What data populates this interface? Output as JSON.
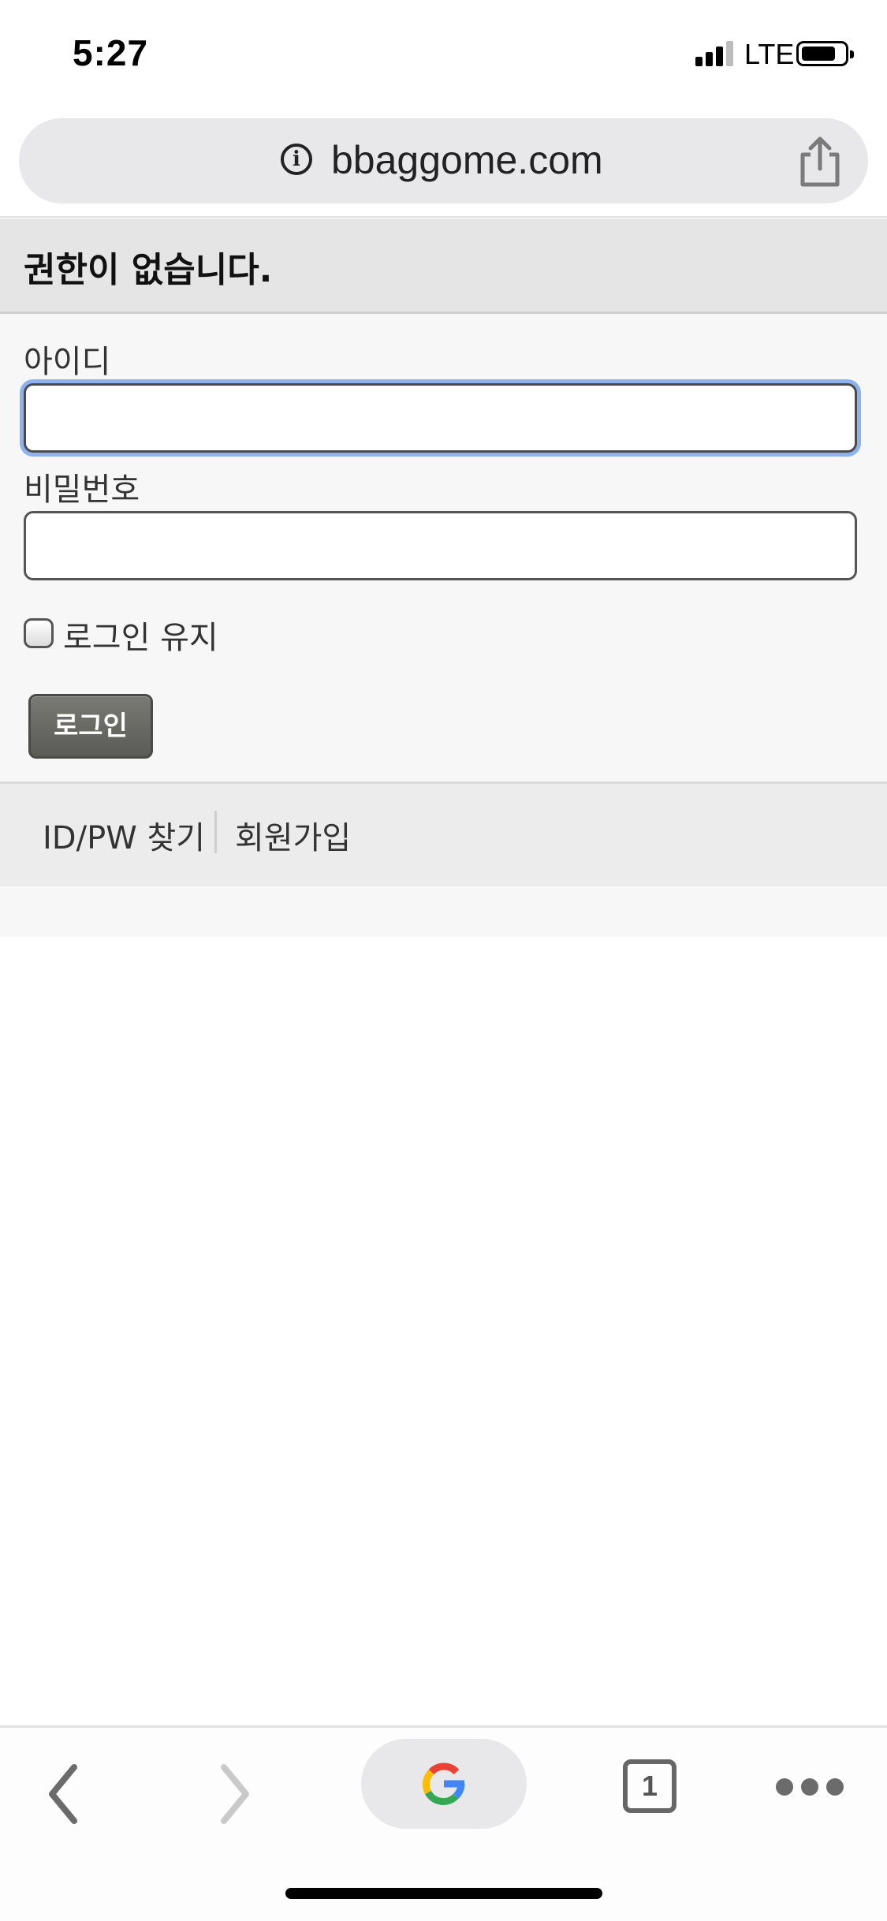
{
  "status_bar": {
    "time": "5:27",
    "network": "LTE"
  },
  "url_bar": {
    "url": "bbaggome.com",
    "info_icon": "i"
  },
  "page": {
    "title": "권한이 없습니다."
  },
  "form": {
    "id_label": "아이디",
    "id_value": "",
    "password_label": "비밀번호",
    "password_value": "",
    "keep_login_label": "로그인 유지",
    "keep_login_checked": false,
    "login_button": "로그인",
    "focus_color": "#8db3ee"
  },
  "links": {
    "find_account": "ID/PW 찾기",
    "signup": "회원가입"
  },
  "toolbar": {
    "tab_count": "1",
    "icons": [
      "back-icon",
      "forward-icon",
      "google-icon",
      "tabs-icon",
      "more-icon"
    ]
  }
}
